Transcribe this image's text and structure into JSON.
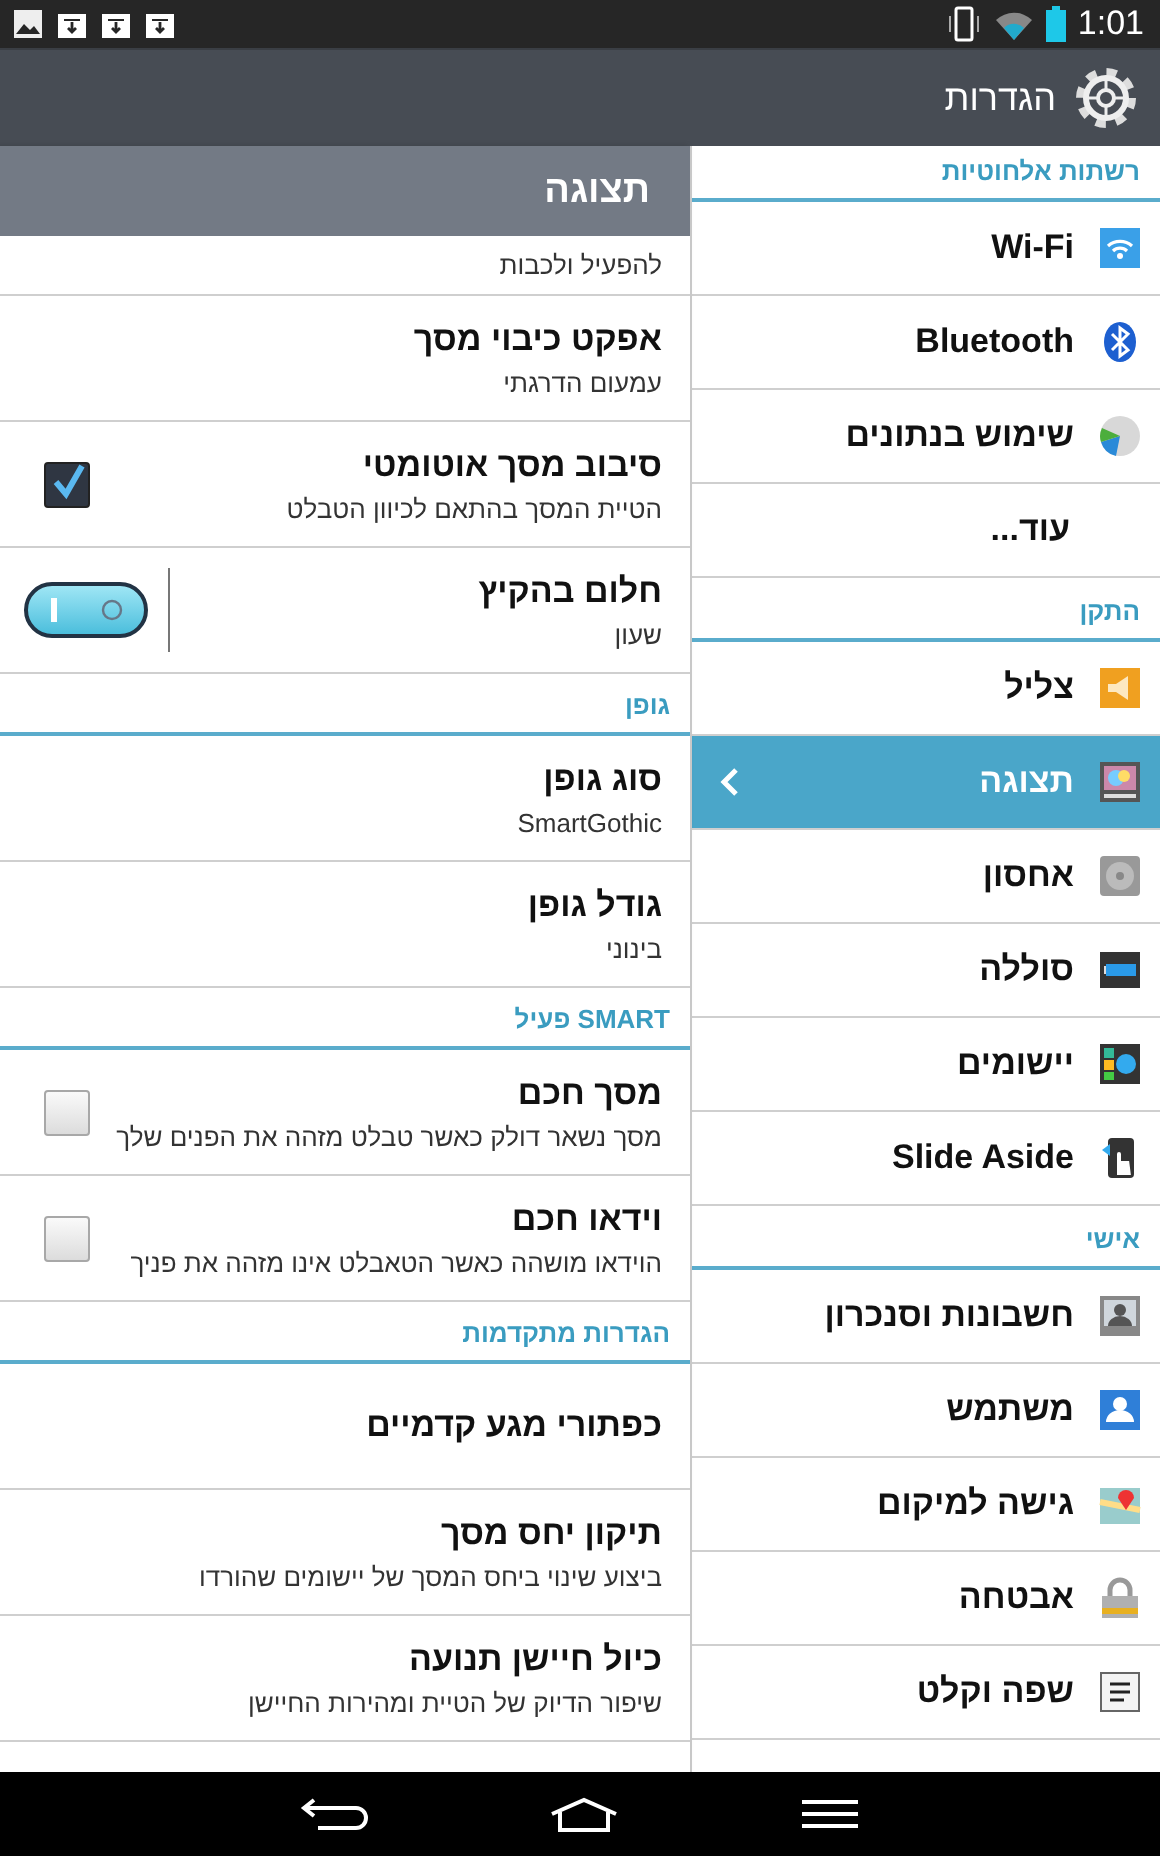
{
  "status_bar": {
    "time": "1:01"
  },
  "action_bar": {
    "title": "הגדרות"
  },
  "settings_list": [
    {
      "header": "רשתות אלחוטיות",
      "items": [
        {
          "label": "Wi-Fi",
          "selected": false
        },
        {
          "label": "Bluetooth",
          "selected": false
        },
        {
          "label": "שימוש בנתונים",
          "selected": false
        },
        {
          "label": "עוד...",
          "selected": false
        }
      ]
    },
    {
      "header": "התקן",
      "items": [
        {
          "label": "צליל",
          "selected": false
        },
        {
          "label": "תצוגה",
          "selected": true
        },
        {
          "label": "אחסון",
          "selected": false
        },
        {
          "label": "סוללה",
          "selected": false
        },
        {
          "label": "יישומים",
          "selected": false
        },
        {
          "label": "Slide Aside",
          "selected": false
        }
      ]
    },
    {
      "header": "אישי",
      "items": [
        {
          "label": "חשבונות וסנכרון",
          "selected": false
        },
        {
          "label": "משתמש",
          "selected": false
        },
        {
          "label": "גישה למיקום",
          "selected": false
        },
        {
          "label": "אבטחה",
          "selected": false
        },
        {
          "label": "שפה וקלט",
          "selected": false
        }
      ]
    }
  ],
  "detail": {
    "title": "תצוגה",
    "sections": [
      {
        "items": [
          {
            "kind": "partial",
            "subtitle": "להפעיל ולכבות"
          },
          {
            "kind": "plain",
            "title": "אפקט כיבוי מסך",
            "subtitle": "עמעום הדרגתי"
          },
          {
            "kind": "checkbox",
            "title": "סיבוב מסך אוטומטי",
            "subtitle": "הטיית המסך בהתאם לכיוון הטבלט",
            "checked": true
          },
          {
            "kind": "switch",
            "title": "חלום בהקיץ",
            "subtitle": "שעון",
            "on": true
          }
        ]
      },
      {
        "header": "גופן",
        "items": [
          {
            "kind": "plain",
            "title": "סוג גופן",
            "subtitle": "SmartGothic"
          },
          {
            "kind": "plain",
            "title": "גודל גופן",
            "subtitle": "בינוני"
          }
        ]
      },
      {
        "header": "SMART פעיל",
        "items": [
          {
            "kind": "checkbox",
            "title": "מסך חכם",
            "subtitle": "מסך נשאר דולק כאשר טבלט מזהה את הפנים שלך",
            "checked": false
          },
          {
            "kind": "checkbox",
            "title": "וידאו חכם",
            "subtitle": "הוידאו מושהה כאשר הטאבלט אינו מזהה את פניך",
            "checked": false
          }
        ]
      },
      {
        "header": "הגדרות מתקדמות",
        "items": [
          {
            "kind": "plain",
            "title": "כפתורי מגע קדמיים"
          },
          {
            "kind": "plain",
            "title": "תיקון יחס מסך",
            "subtitle": "ביצוע שינוי ביחס המסך של יישומים שהורדו"
          },
          {
            "kind": "plain",
            "title": "כיול חיישן תנועה",
            "subtitle": "שיפור הדיוק של הטיית ומהירות החיישן"
          }
        ]
      }
    ]
  }
}
